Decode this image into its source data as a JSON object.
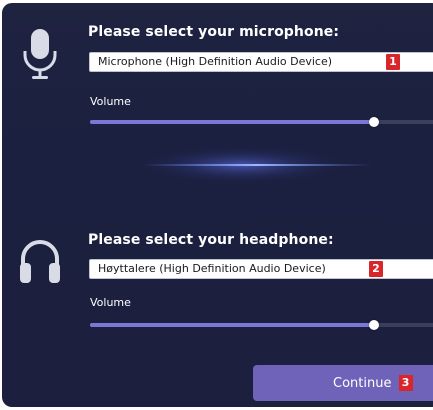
{
  "microphone": {
    "heading": "Please select your microphone:",
    "selected_device": "Microphone (High Definition Audio Device)",
    "badge": "1",
    "volume_label": "Volume",
    "volume_level": 0.79
  },
  "headphone": {
    "heading": "Please select your headphone:",
    "selected_device": "Høyttalere (High Definition Audio Device)",
    "badge": "2",
    "volume_label": "Volume",
    "volume_level": 0.79
  },
  "continue_button": {
    "label": "Continue",
    "badge": "3"
  },
  "icons": {
    "microphone": "microphone-icon",
    "headphone": "headphones-icon"
  },
  "colors": {
    "panel_background": "#1c2040",
    "slider_fill": "#7a78d6",
    "button": "#6e63b8",
    "badge": "#d8262b"
  }
}
